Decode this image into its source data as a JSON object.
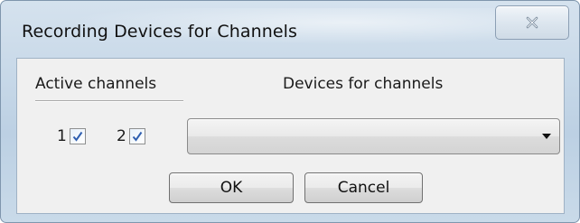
{
  "window": {
    "title": "Recording Devices for Channels"
  },
  "titlebar": {
    "close_icon": "close-icon"
  },
  "headers": {
    "active_channels": "Active channels",
    "devices_for_channels": "Devices for channels"
  },
  "channels": [
    {
      "label": "1",
      "checked": true
    },
    {
      "label": "2",
      "checked": true
    }
  ],
  "device_select": {
    "value": ""
  },
  "buttons": {
    "ok": "OK",
    "cancel": "Cancel"
  },
  "colors": {
    "accent_check": "#2f5fb0",
    "frame": "#c7d8e8"
  }
}
